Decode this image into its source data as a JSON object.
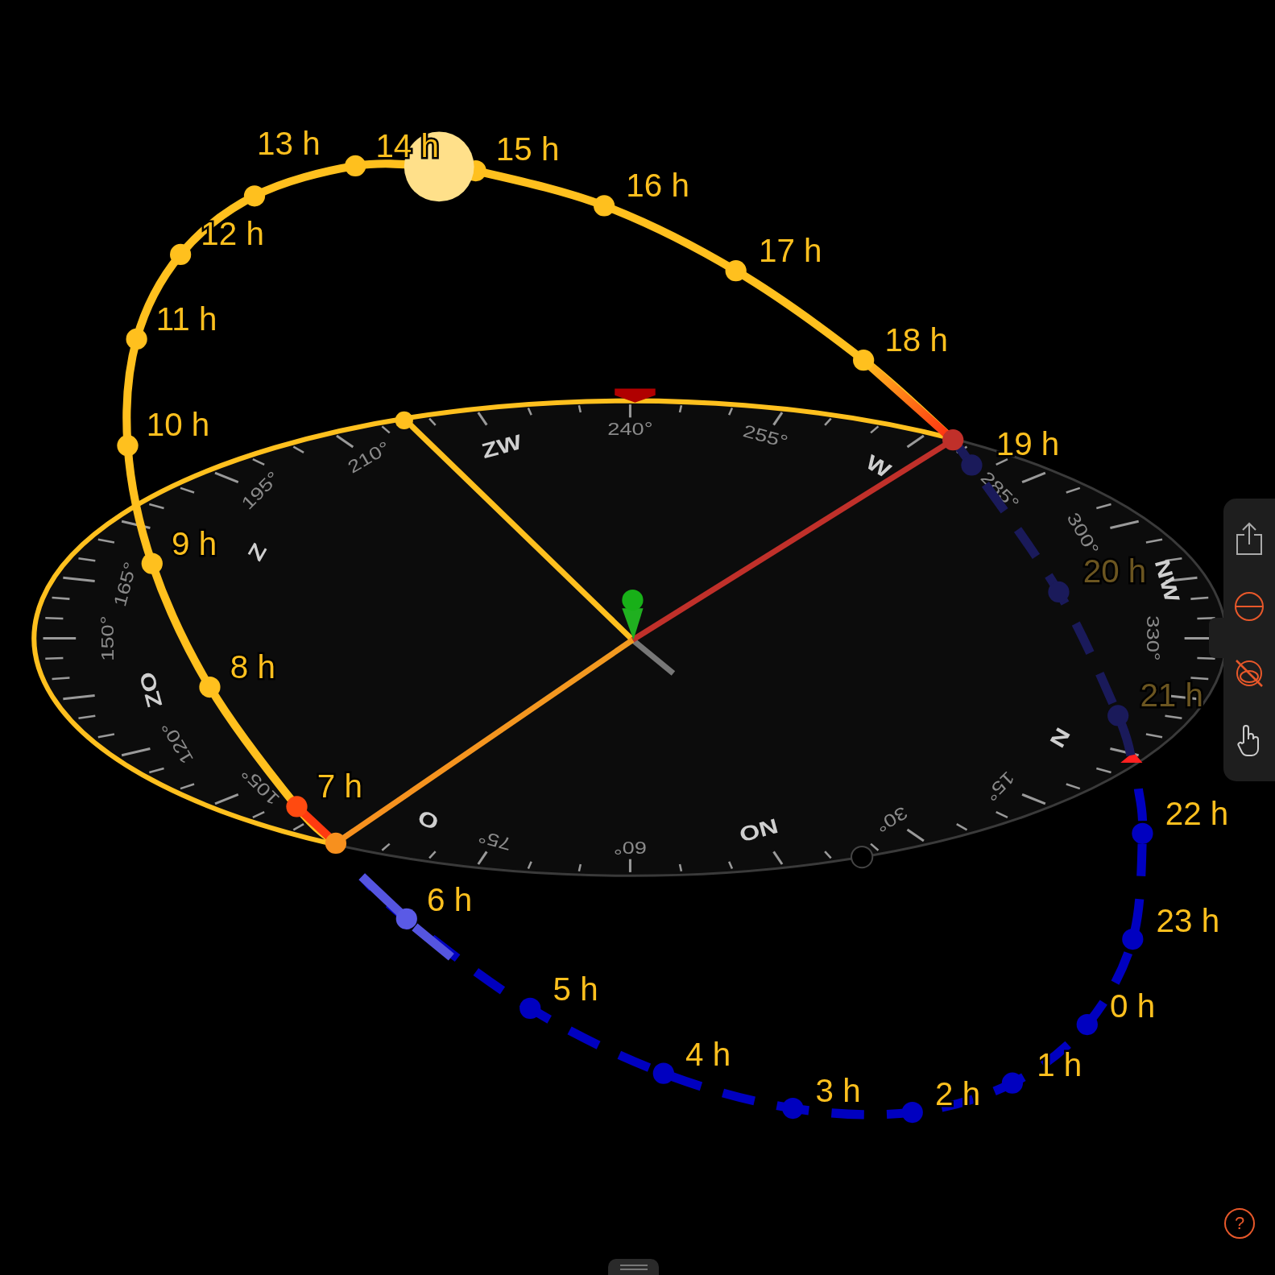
{
  "compass": {
    "degree_labels": [
      {
        "label": "240°"
      },
      {
        "label": "255°"
      },
      {
        "label": "210°"
      },
      {
        "label": "195°"
      },
      {
        "label": "285°"
      },
      {
        "label": "300°"
      },
      {
        "label": "165°"
      },
      {
        "label": "330°"
      },
      {
        "label": "150°"
      },
      {
        "label": "120°"
      },
      {
        "label": "105°"
      },
      {
        "label": "15°"
      },
      {
        "label": "30°"
      },
      {
        "label": "75°"
      },
      {
        "label": "60°"
      }
    ],
    "direction_labels": [
      {
        "label": "ZW"
      },
      {
        "label": "W"
      },
      {
        "label": "Z"
      },
      {
        "label": "NW"
      },
      {
        "label": "ZO"
      },
      {
        "label": "N"
      },
      {
        "label": "O"
      },
      {
        "label": "NO"
      }
    ]
  },
  "sun_path": {
    "hours": [
      {
        "label": "13 h",
        "kind": "day",
        "dimmed": false
      },
      {
        "label": "14 h",
        "kind": "day",
        "dimmed": false
      },
      {
        "label": "15 h",
        "kind": "day",
        "dimmed": false
      },
      {
        "label": "16 h",
        "kind": "day",
        "dimmed": false
      },
      {
        "label": "12 h",
        "kind": "day",
        "dimmed": false
      },
      {
        "label": "17 h",
        "kind": "day",
        "dimmed": false
      },
      {
        "label": "11 h",
        "kind": "day",
        "dimmed": false
      },
      {
        "label": "18 h",
        "kind": "day",
        "dimmed": false
      },
      {
        "label": "10 h",
        "kind": "day",
        "dimmed": false
      },
      {
        "label": "19 h",
        "kind": "sunset",
        "dimmed": false
      },
      {
        "label": "9 h",
        "kind": "day",
        "dimmed": false
      },
      {
        "label": "20 h",
        "kind": "night",
        "dimmed": true
      },
      {
        "label": "8 h",
        "kind": "day",
        "dimmed": false
      },
      {
        "label": "21 h",
        "kind": "night",
        "dimmed": true
      },
      {
        "label": "7 h",
        "kind": "sunrise",
        "dimmed": false
      },
      {
        "label": "22 h",
        "kind": "night",
        "dimmed": false
      },
      {
        "label": "6 h",
        "kind": "twilight",
        "dimmed": false
      },
      {
        "label": "23 h",
        "kind": "night",
        "dimmed": false
      },
      {
        "label": "5 h",
        "kind": "night",
        "dimmed": false
      },
      {
        "label": "0 h",
        "kind": "night",
        "dimmed": false
      },
      {
        "label": "4 h",
        "kind": "night",
        "dimmed": false
      },
      {
        "label": "1 h",
        "kind": "night",
        "dimmed": false
      },
      {
        "label": "3 h",
        "kind": "night",
        "dimmed": false
      },
      {
        "label": "2 h",
        "kind": "night",
        "dimmed": false
      }
    ]
  },
  "help_button": {
    "label": "?"
  }
}
